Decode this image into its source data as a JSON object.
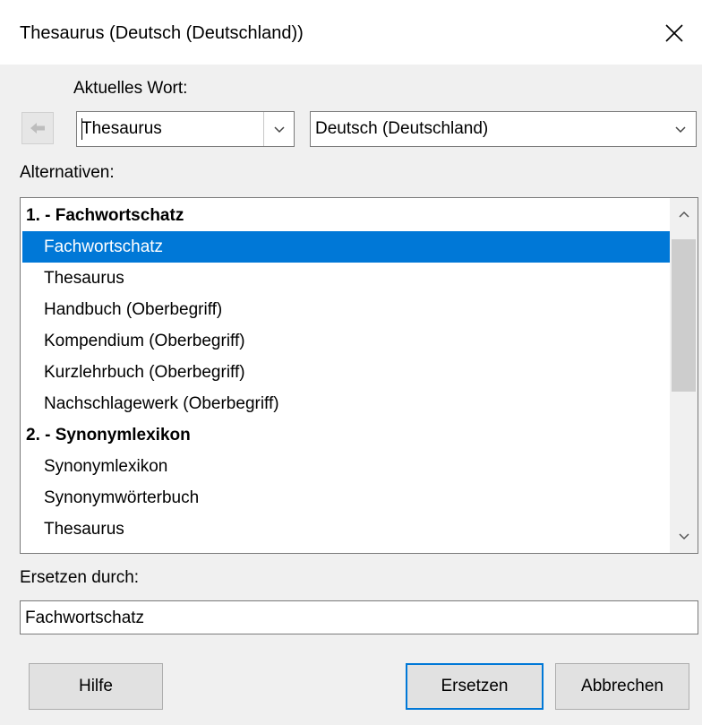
{
  "window": {
    "title": "Thesaurus (Deutsch (Deutschland))"
  },
  "current_word": {
    "label": "Aktuelles Wort:",
    "value": "Thesaurus",
    "language": "Deutsch (Deutschland)"
  },
  "alternatives": {
    "label": "Alternativen:",
    "rows": [
      {
        "text": "1. - Fachwortschatz",
        "kind": "heading"
      },
      {
        "text": "Fachwortschatz",
        "kind": "item",
        "selected": true
      },
      {
        "text": "Thesaurus",
        "kind": "item"
      },
      {
        "text": "Handbuch (Oberbegriff)",
        "kind": "item"
      },
      {
        "text": "Kompendium (Oberbegriff)",
        "kind": "item"
      },
      {
        "text": "Kurzlehrbuch (Oberbegriff)",
        "kind": "item"
      },
      {
        "text": "Nachschlagewerk (Oberbegriff)",
        "kind": "item"
      },
      {
        "text": "2. - Synonymlexikon",
        "kind": "heading"
      },
      {
        "text": "Synonymlexikon",
        "kind": "item"
      },
      {
        "text": "Synonymwörterbuch",
        "kind": "item"
      },
      {
        "text": "Thesaurus",
        "kind": "item"
      }
    ]
  },
  "replace": {
    "label": "Ersetzen durch:",
    "value": "Fachwortschatz"
  },
  "buttons": {
    "help": "Hilfe",
    "replace": "Ersetzen",
    "cancel": "Abbrechen"
  },
  "colors": {
    "selection": "#0078d7",
    "default_button_border": "#0078d7"
  },
  "icons": {
    "close": "close-icon",
    "back": "arrow-left-icon",
    "dropdown": "chevron-down-icon",
    "scroll_up": "chevron-up-icon",
    "scroll_down": "chevron-down-icon"
  }
}
